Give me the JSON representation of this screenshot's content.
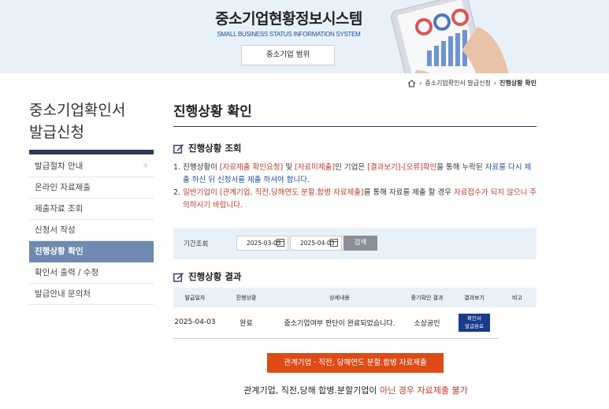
{
  "header": {
    "title": "중소기업현황정보시스템",
    "subtitle": "SMALL BUSINESS STATUS INFORMATION SYSTEM",
    "scope_button": "중소기업 범위"
  },
  "breadcrumb": {
    "icon": "home-icon",
    "items": [
      "중소기업확인서 발급신청",
      "진행상황 확인"
    ]
  },
  "sidebar": {
    "title_line1": "중소기업확인서",
    "title_line2": "발급신청",
    "items": [
      {
        "label": "발급절차 안내",
        "extra": "+"
      },
      {
        "label": "온라인 자료제출"
      },
      {
        "label": "제출자료 조회"
      },
      {
        "label": "신청서 작성"
      },
      {
        "label": "진행상황 확인"
      },
      {
        "label": "확인서 출력 / 수정"
      },
      {
        "label": "발급안내 문의처"
      }
    ]
  },
  "main": {
    "title": "진행상황 확인",
    "inquiry_heading": "진행상황 조회",
    "notice1": {
      "num": "1.",
      "t1": "진행상황이 ",
      "r1": "[자료제출 확인요청]",
      "t2": " 및 ",
      "r2": "[자료미제출]",
      "t3": "인 기업은 ",
      "r3": "[결과보기]-[오류]확인",
      "t4": "을 통해 누락된 ",
      "b1": "자료를 다시 제출 하신 뒤 신청서를 제출 하셔야 합니다."
    },
    "notice2": {
      "num": "2.",
      "r1": "일반기업이 [관계기업, 직전.당해연도 분할.합병 자료제출]",
      "t1": "를 통해 자료를 제출 할 경우 ",
      "r2": "자료접수가 되지 않으니 주의하시기 바랍니다."
    },
    "search": {
      "label": "기간조회",
      "date_from": "2025-03-03",
      "date_to": "2025-04-03",
      "button": "검색"
    },
    "result_heading": "진행상황 결과",
    "table": {
      "headers": [
        "발급일자",
        "진행상황",
        "상세내용",
        "중기확인 결과",
        "결과보기",
        "비고"
      ],
      "rows": [
        {
          "date": "2025-04-03",
          "status": "완료",
          "detail": "중소기업여부 판단이 완료되었습니다.",
          "result": "소상공인",
          "view_line1": "확인서",
          "view_line2": "발급완료",
          "note": ""
        }
      ]
    },
    "submit_button": "관계기업 · 직전, 당해연도 분할.합병 자료제출",
    "bottom_note_a": "관계기업, 직전,당해 합병.분할기업이 ",
    "bottom_note_b": "아닌 경우 자료제출 불가"
  },
  "colors": {
    "accent_navy": "#2e3a59",
    "active_menu": "#6e8ab0",
    "banner_bg": "#e9f1f8",
    "submit_orange": "#dd4b16",
    "badge_blue": "#1a3a8a",
    "warning_red": "#c0392b",
    "link_blue": "#1f4e9a"
  }
}
